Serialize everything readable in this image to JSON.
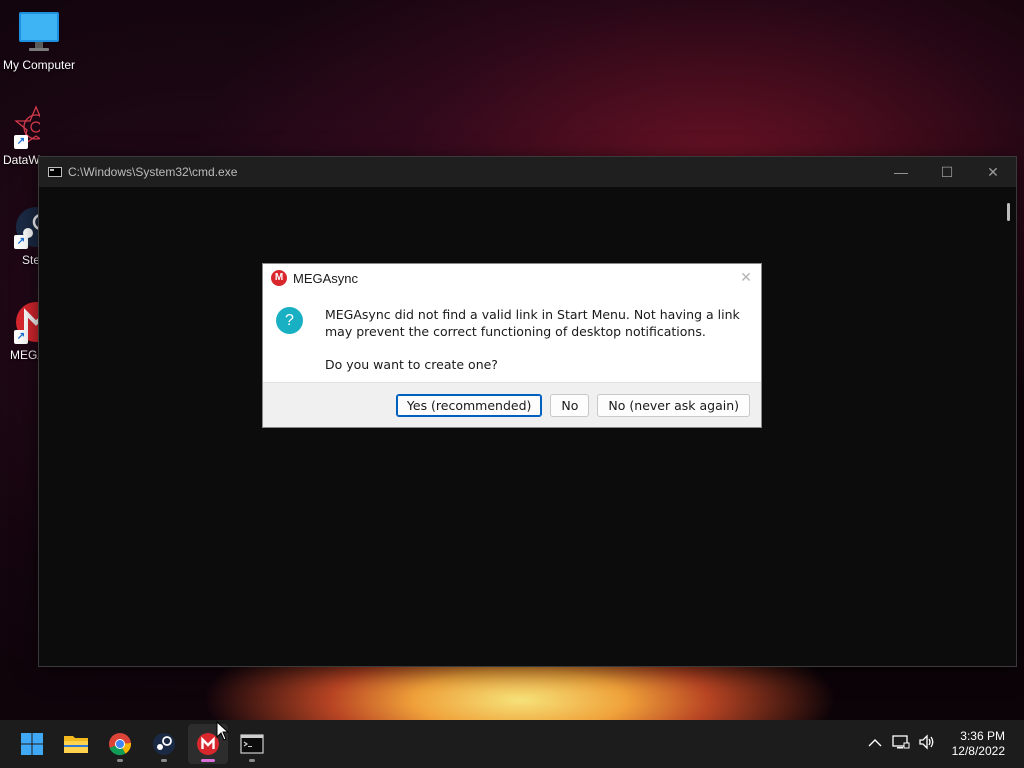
{
  "desktop": {
    "icons": [
      {
        "label": "My Computer",
        "icon": "monitor-icon"
      },
      {
        "label": "DataW",
        "icon": "datawrapper-icon"
      },
      {
        "label": "Ste",
        "icon": "steam-icon"
      },
      {
        "label": "MEGA",
        "icon": "mega-icon"
      }
    ]
  },
  "cmd_window": {
    "title": "C:\\Windows\\System32\\cmd.exe",
    "minimize": "—",
    "maximize": "☐",
    "close": "✕"
  },
  "dialog": {
    "title": "MEGAsync",
    "logo_letter": "M",
    "close": "✕",
    "icon_glyph": "?",
    "message": "MEGAsync did not find a valid link in Start Menu. Not having a link may prevent the correct functioning of desktop notifications.",
    "question": "Do you want to create one?",
    "buttons": {
      "yes": "Yes (recommended)",
      "no": "No",
      "never": "No (never ask again)"
    }
  },
  "taskbar": {
    "apps": [
      {
        "name": "start",
        "icon": "windows-start-icon"
      },
      {
        "name": "file-explorer",
        "icon": "folder-icon"
      },
      {
        "name": "chrome",
        "icon": "chrome-icon"
      },
      {
        "name": "steam",
        "icon": "steam-icon"
      },
      {
        "name": "megasync",
        "icon": "mega-icon",
        "active": true
      },
      {
        "name": "cmd",
        "icon": "terminal-icon"
      }
    ],
    "tray": {
      "chevron": "^",
      "time": "3:36 PM",
      "date": "12/8/2022"
    }
  },
  "colors": {
    "mega_red": "#d9272e",
    "question_teal": "#1ab0c4",
    "primary_border": "#0060c0",
    "active_indicator": "#d86fd9"
  }
}
